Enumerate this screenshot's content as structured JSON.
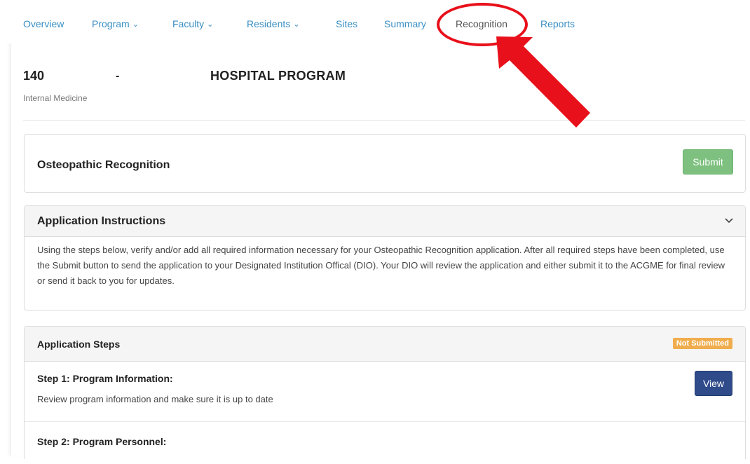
{
  "nav": {
    "items": [
      {
        "label": "Overview",
        "dropdown": false
      },
      {
        "label": "Program",
        "dropdown": true
      },
      {
        "label": "Faculty",
        "dropdown": true
      },
      {
        "label": "Residents",
        "dropdown": true
      },
      {
        "label": "Sites",
        "dropdown": false
      },
      {
        "label": "Summary",
        "dropdown": false
      },
      {
        "label": "Recognition",
        "dropdown": false,
        "active": true
      },
      {
        "label": "Reports",
        "dropdown": false
      }
    ],
    "chevron": "⌄"
  },
  "program": {
    "number": "140",
    "dash": "-",
    "name": "HOSPITAL PROGRAM",
    "specialty": "Internal Medicine"
  },
  "recognition_panel": {
    "title": "Osteopathic Recognition",
    "submit_label": "Submit"
  },
  "instructions_panel": {
    "title": "Application Instructions",
    "text": "Using the steps below, verify and/or add all required information necessary for your Osteopathic Recognition application. After all required steps have been completed, use the Submit button to send the application to your Designated Institution Offical (DIO). Your DIO will review the application and either submit it to the ACGME for final review or send it back to you for updates."
  },
  "steps_panel": {
    "title": "Application Steps",
    "status": "Not Submitted",
    "steps": [
      {
        "title": "Step 1: Program Information:",
        "description": "Review program information and make sure it is up to date",
        "button": "View"
      },
      {
        "title": "Step 2: Program Personnel:"
      }
    ]
  },
  "colors": {
    "link": "#3a8fc5",
    "submit": "#7dc07f",
    "view": "#2f4b8a",
    "badge": "#f0ad4e",
    "annotation": "#e8101a"
  },
  "icons": [
    "chevron-down-icon",
    "highlight-oval",
    "red-arrow"
  ]
}
